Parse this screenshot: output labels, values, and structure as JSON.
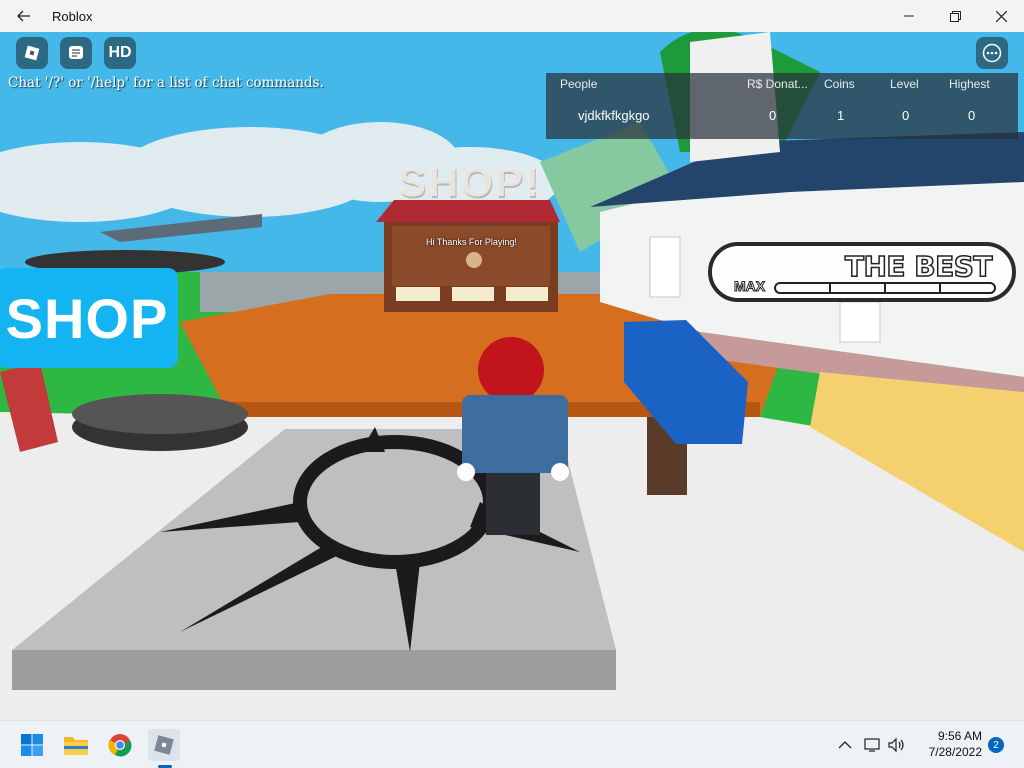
{
  "window": {
    "title": "Roblox"
  },
  "game": {
    "top_buttons": [
      {
        "name": "roblox-menu-icon"
      },
      {
        "name": "chat-icon"
      },
      {
        "name": "hd-icon",
        "label": "HD"
      }
    ],
    "chat_hint": "Chat '/?' or '/help' for a list of chat commands.",
    "leaderboard": {
      "columns": [
        "People",
        "R$ Donat...",
        "Coins",
        "Level",
        "Highest"
      ],
      "rows": [
        {
          "player": "vjdkfkfkgkgo",
          "donated": "0",
          "coins": "1",
          "level": "0",
          "highest": "0"
        }
      ]
    },
    "shop_sign": "SHOP",
    "shop_3d_text": "SHOP!",
    "stall_text": "Hi Thanks For Playing!",
    "best_panel": {
      "title": "THE BEST",
      "max_label": "MAX",
      "progress": 0
    }
  },
  "taskbar": {
    "apps": [
      {
        "name": "start-icon"
      },
      {
        "name": "file-explorer-icon"
      },
      {
        "name": "chrome-icon"
      },
      {
        "name": "roblox-app-icon"
      }
    ],
    "time": "9:56 AM",
    "date": "7/28/2022",
    "notifications": "2"
  },
  "colors": {
    "sky": "#3fb6e8",
    "shop_sign": "#14b4f2",
    "taskbar": "#eef1f5"
  }
}
